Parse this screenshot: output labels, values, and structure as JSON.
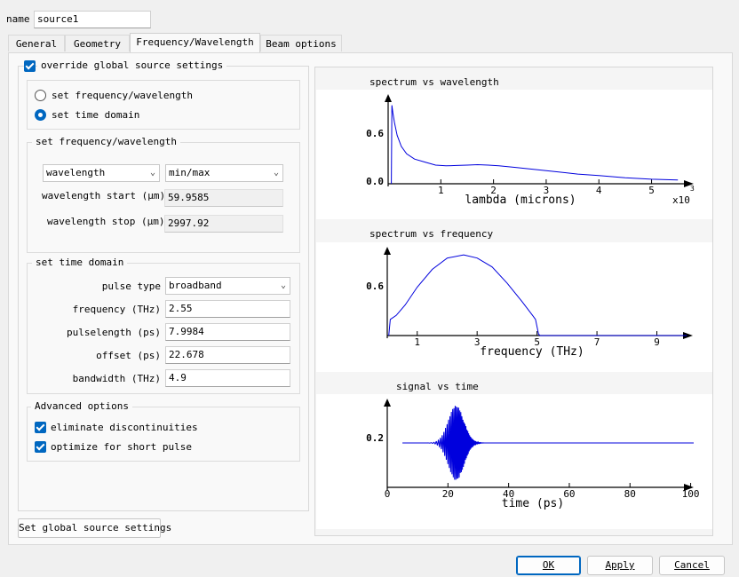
{
  "name_field": {
    "label": "name",
    "value": "source1"
  },
  "tabs": [
    {
      "label": "General"
    },
    {
      "label": "Geometry"
    },
    {
      "label": "Frequency/Wavelength"
    },
    {
      "label": "Beam options"
    }
  ],
  "override": {
    "label": "override global source settings",
    "checked": true
  },
  "mode": {
    "options": [
      "set frequency/wavelength",
      "set time domain"
    ],
    "selected": "set time domain"
  },
  "freq_wave": {
    "title": "set frequency/wavelength",
    "unit_select": "wavelength",
    "range_select": "min/max",
    "start_label": "wavelength start (μm)",
    "start_value": "59.9585",
    "stop_label": "wavelength stop (μm)",
    "stop_value": "2997.92"
  },
  "time_domain": {
    "title": "set time domain",
    "pulse_type_label": "pulse type",
    "pulse_type_value": "broadband",
    "frequency_label": "frequency (THz)",
    "frequency_value": "2.55",
    "pulselength_label": "pulselength (ps)",
    "pulselength_value": "7.9984",
    "offset_label": "offset (ps)",
    "offset_value": "22.678",
    "bandwidth_label": "bandwidth (THz)",
    "bandwidth_value": "4.9"
  },
  "advanced": {
    "title": "Advanced options",
    "eliminate_label": "eliminate discontinuities",
    "eliminate_checked": true,
    "optimize_label": "optimize for short pulse",
    "optimize_checked": true
  },
  "global_button": "Set global source settings",
  "footer": {
    "ok": "OK",
    "apply": "Apply",
    "cancel": "Cancel"
  },
  "colors": {
    "accent": "#0067c0",
    "curve": "#0000dd"
  },
  "chart_data": [
    {
      "type": "line",
      "title": "spectrum vs wavelength",
      "xlabel": "lambda (microns)",
      "x_multiplier": "x10",
      "x_multiplier_exp": "3",
      "xticks": [
        "1",
        "2",
        "3",
        "4",
        "5"
      ],
      "yticks": [
        "0.0",
        "0.6"
      ],
      "xlim": [
        0,
        5.8
      ],
      "ylim": [
        0,
        1.2
      ],
      "x": [
        0.06,
        0.07,
        0.09,
        0.12,
        0.17,
        0.25,
        0.35,
        0.5,
        0.7,
        0.9,
        1.1,
        1.3,
        1.5,
        1.7,
        1.9,
        2.1,
        2.4,
        2.8,
        3.2,
        3.6,
        4.0,
        4.5,
        5.0,
        5.5
      ],
      "y": [
        0.0,
        1.05,
        0.95,
        0.82,
        0.65,
        0.5,
        0.4,
        0.33,
        0.29,
        0.25,
        0.24,
        0.245,
        0.25,
        0.255,
        0.25,
        0.24,
        0.22,
        0.19,
        0.16,
        0.13,
        0.11,
        0.08,
        0.06,
        0.05
      ]
    },
    {
      "type": "line",
      "title": "spectrum vs frequency",
      "xlabel": "frequency (THz)",
      "xticks": [
        "1",
        "3",
        "5",
        "7",
        "9"
      ],
      "yticks": [
        "0.6"
      ],
      "xlim": [
        0,
        10.2
      ],
      "ylim": [
        0,
        1.1
      ],
      "x": [
        0.05,
        0.1,
        0.3,
        0.6,
        1.0,
        1.5,
        2.0,
        2.55,
        3.0,
        3.5,
        4.0,
        4.5,
        4.85,
        4.95,
        5.05,
        5.1,
        7.0,
        10.0
      ],
      "y": [
        0.0,
        0.2,
        0.25,
        0.38,
        0.6,
        0.82,
        0.96,
        1.0,
        0.96,
        0.85,
        0.65,
        0.42,
        0.25,
        0.2,
        0.02,
        0.0,
        0.0,
        0.0
      ]
    },
    {
      "type": "line",
      "title": "signal vs time",
      "xlabel": "time (ps)",
      "xticks": [
        "0",
        "20",
        "40",
        "60",
        "80",
        "100"
      ],
      "yticks": [
        "0.2"
      ],
      "xlim": [
        0,
        101
      ],
      "ylim": [
        -0.45,
        0.45
      ],
      "baseline": 0,
      "pulse_center_ps": 22.678,
      "pulse_length_ps": 7.9984,
      "carrier_thz": 2.55,
      "amplitude": 0.38
    }
  ]
}
